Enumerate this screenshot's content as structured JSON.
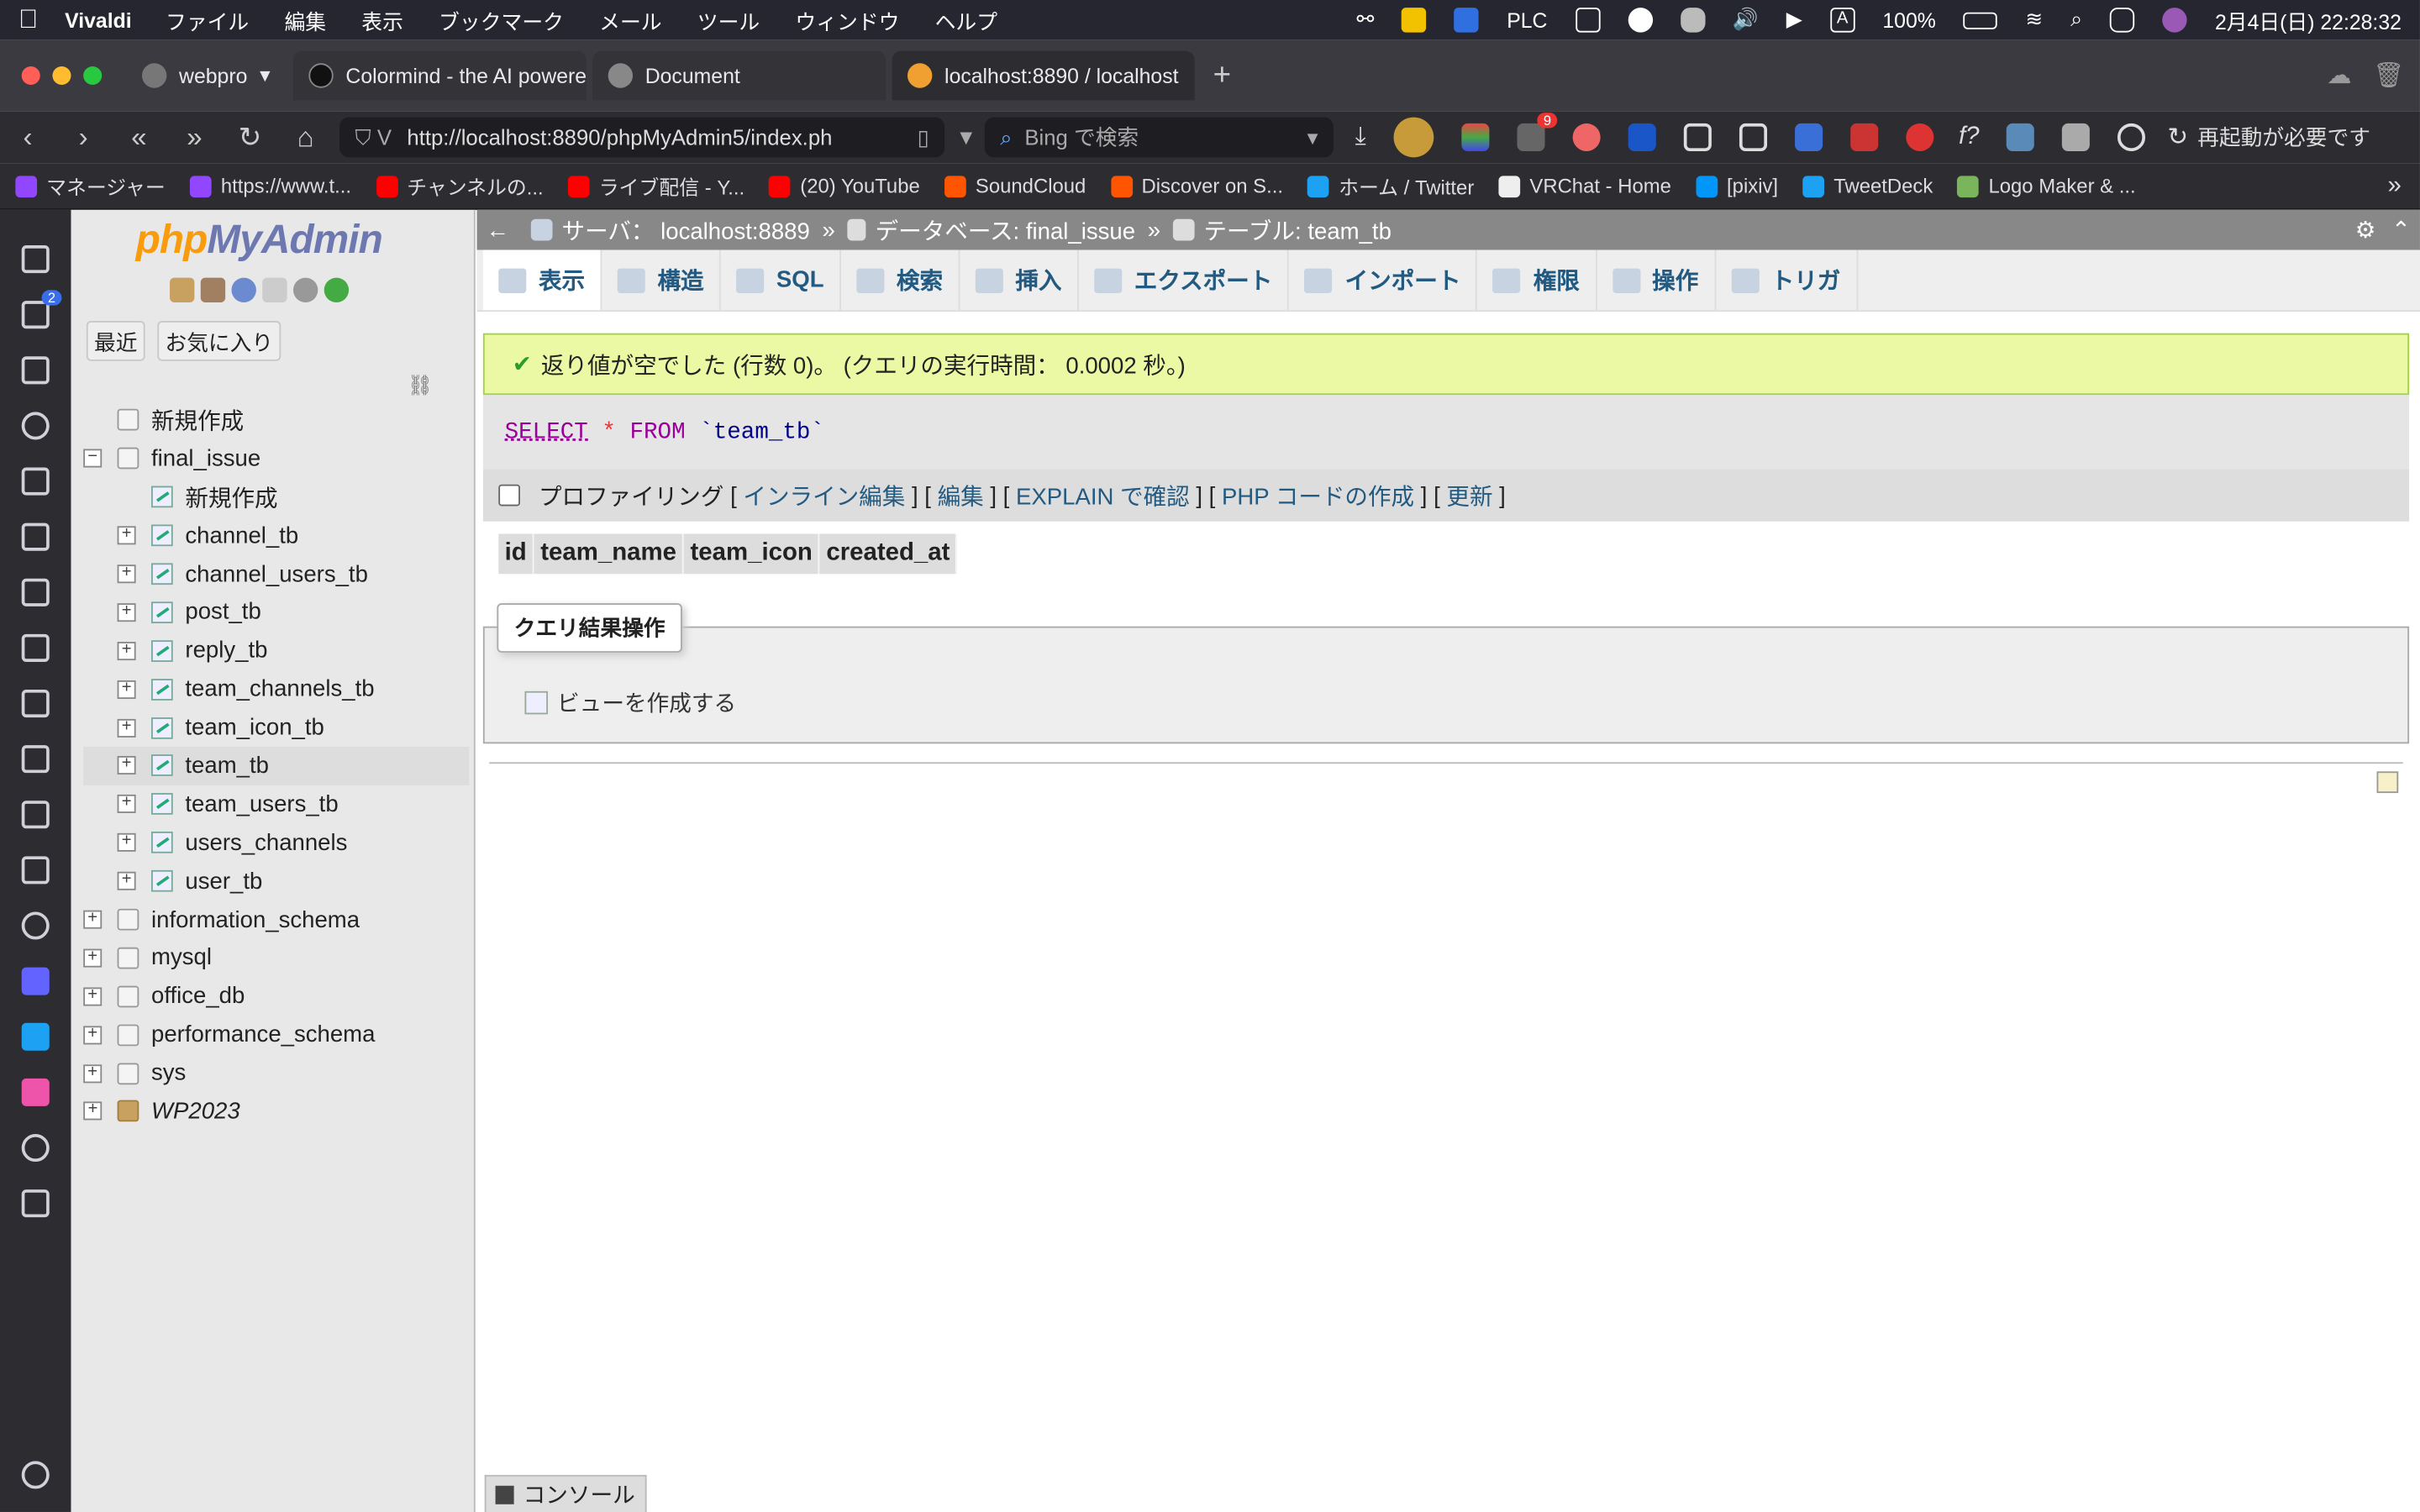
{
  "menubar": {
    "app": "Vivaldi",
    "items": [
      "ファイル",
      "編集",
      "表示",
      "ブックマーク",
      "メール",
      "ツール",
      "ウィンドウ",
      "ヘルプ"
    ],
    "plc": "PLC",
    "battery": "100%",
    "datetime": "2月4日(日) 22:28:32"
  },
  "tabs": [
    {
      "label": "webpro"
    },
    {
      "label": "Colormind - the AI powered"
    },
    {
      "label": "Document"
    },
    {
      "label": "localhost:8890 / localhost"
    }
  ],
  "address": {
    "url": "http://localhost:8890/phpMyAdmin5/index.ph",
    "search_placeholder": "Bing で検索",
    "restart": "再起動が必要です",
    "notif_badge": "9"
  },
  "bookmarks": [
    "マネージャー",
    "https://www.t...",
    "チャンネルの...",
    "ライブ配信 - Y...",
    "(20) YouTube",
    "SoundCloud",
    "Discover on S...",
    "ホーム / Twitter",
    "VRChat - Home",
    "[pixiv]",
    "TweetDeck",
    "Logo Maker & ..."
  ],
  "panel_badge": "2",
  "pma": {
    "logo_php": "php",
    "logo_my": "MyAdmin",
    "btn_recent": "最近",
    "btn_fav": "お気に入り",
    "tree": {
      "new": "新規作成",
      "db": "final_issue",
      "db_new": "新規作成",
      "tables": [
        "channel_tb",
        "channel_users_tb",
        "post_tb",
        "reply_tb",
        "team_channels_tb",
        "team_icon_tb",
        "team_tb",
        "team_users_tb",
        "users_channels",
        "user_tb"
      ],
      "dbs": [
        "information_schema",
        "mysql",
        "office_db",
        "performance_schema",
        "sys",
        "WP2023"
      ]
    }
  },
  "main": {
    "breadcrumb": {
      "server": "サーバ： localhost:8889",
      "database": "データベース: final_issue",
      "table": "テーブル: team_tb"
    },
    "tabs": [
      "表示",
      "構造",
      "SQL",
      "検索",
      "挿入",
      "エクスポート",
      "インポート",
      "権限",
      "操作",
      "トリガ"
    ],
    "success": "返り値が空でした (行数 0)。 (クエリの実行時間： 0.0002 秒。)",
    "sql": {
      "select": "SELECT",
      "star": "*",
      "from": "FROM",
      "table": "`team_tb`"
    },
    "profiling": "プロファイリング",
    "links": [
      "インライン編集",
      "編集",
      "EXPLAIN で確認",
      "PHP コードの作成",
      "更新"
    ],
    "columns": [
      "id",
      "team_name",
      "team_icon",
      "created_at"
    ],
    "query_ops": "クエリ結果操作",
    "create_view": "ビューを作成する",
    "console": "コンソール"
  }
}
